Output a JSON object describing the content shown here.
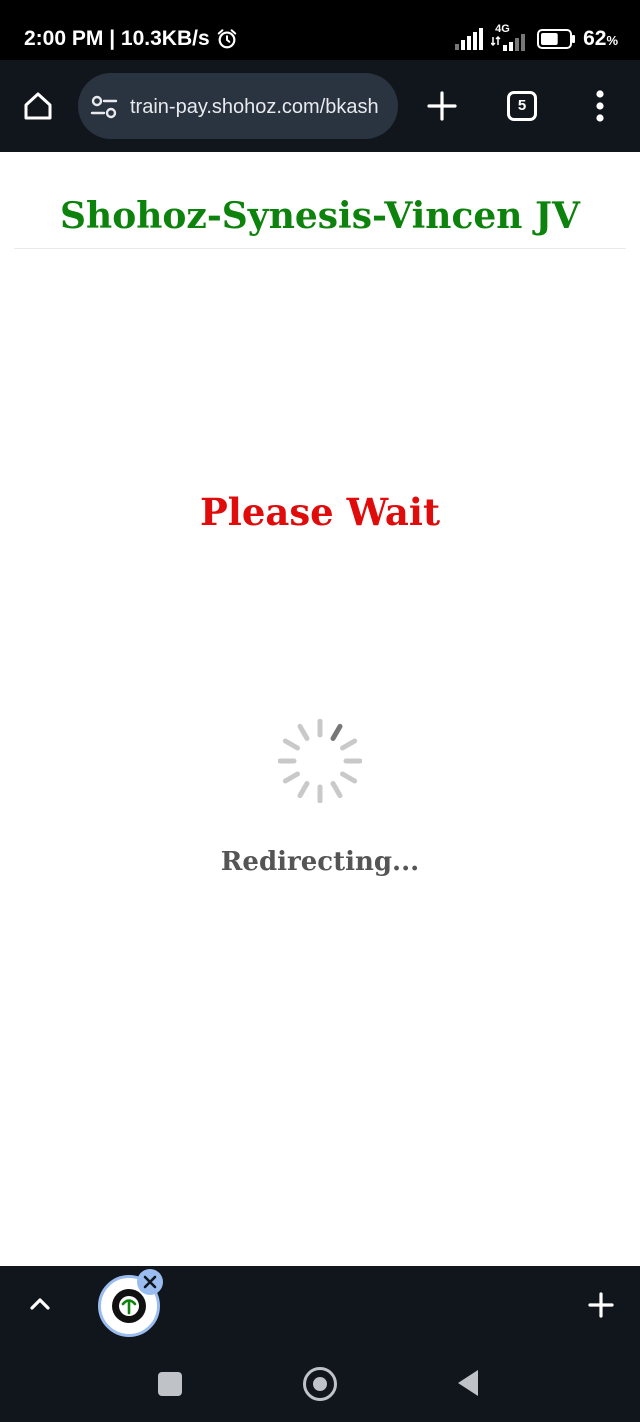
{
  "status_bar": {
    "time_and_speed": "2:00 PM | 10.3KB/s",
    "network_type": "4G",
    "battery_percent": "62",
    "battery_unit": "%",
    "battery_level": 0.62
  },
  "browser": {
    "url": "train-pay.shohoz.com/bkash",
    "tab_count": "5"
  },
  "page": {
    "title": "Shohoz-Synesis-Vincen JV",
    "wait_message": "Please Wait",
    "status_message": "Redirecting...",
    "colors": {
      "title": "#0d820d",
      "wait": "#e00b0b",
      "status": "#555555"
    }
  },
  "icons": {
    "home": "home-icon",
    "site_settings": "tune-icon",
    "new_tab": "plus-icon",
    "menu": "more-vert-icon",
    "spinner": "loading-spinner-icon"
  }
}
